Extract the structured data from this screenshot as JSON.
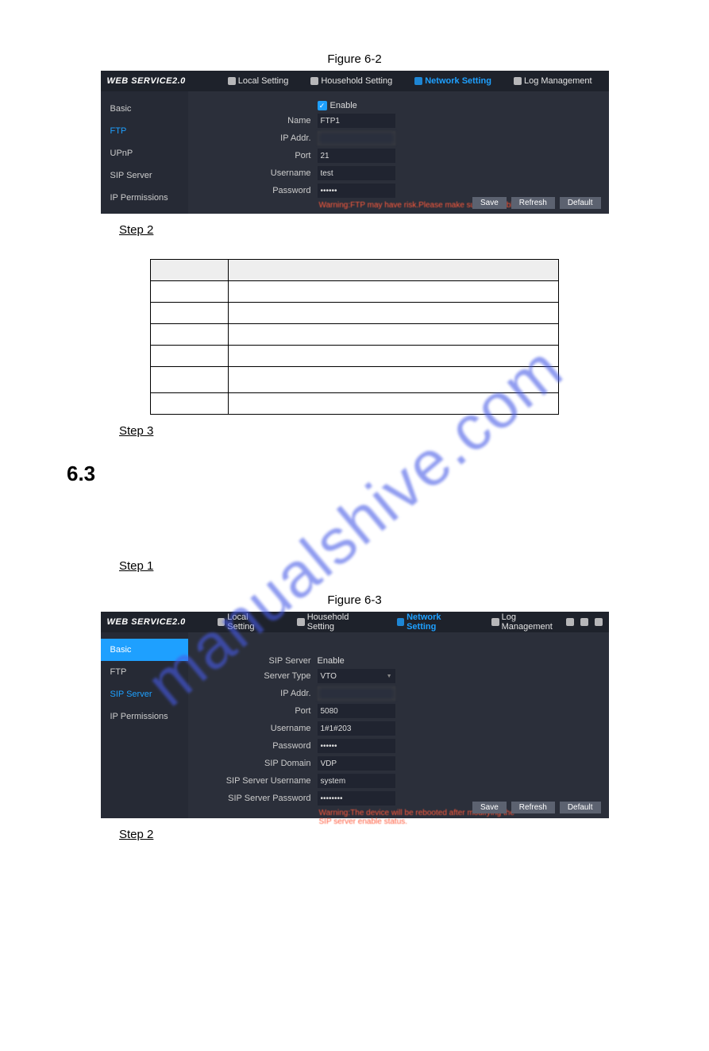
{
  "watermark": "manualshive.com",
  "figure1_caption": "Figure 6-2",
  "figure2_caption": "Figure 6-3",
  "step1_text": "Step 1",
  "step2_text": "Step 2",
  "step3_text": "Step 3",
  "section_num": "6.3",
  "shot": {
    "logo": "WEB SERVICE2.0",
    "nav": {
      "local": "Local Setting",
      "household": "Household Setting",
      "network": "Network Setting",
      "log": "Log Management"
    },
    "sidebar": {
      "basic": "Basic",
      "ftp": "FTP",
      "upnp": "UPnP",
      "sip": "SIP Server",
      "ipperm": "IP Permissions"
    },
    "buttons": {
      "save": "Save",
      "refresh": "Refresh",
      "default": "Default"
    }
  },
  "ftp_form": {
    "enable_label": "Enable",
    "name_label": "Name",
    "name_value": "FTP1",
    "ip_label": "IP Addr.",
    "ip_value": "",
    "port_label": "Port",
    "port_value": "21",
    "user_label": "Username",
    "user_value": "test",
    "pass_label": "Password",
    "pass_value": "••••••",
    "warning": "Warning:FTP may have risk.Please make sure to enable."
  },
  "sip_form": {
    "sipserver_label": "SIP Server",
    "enable_label": "Enable",
    "servertype_label": "Server Type",
    "servertype_value": "VTO",
    "ip_label": "IP Addr.",
    "ip_value": "",
    "port_label": "Port",
    "port_value": "5080",
    "user_label": "Username",
    "user_value": "1#1#203",
    "pass_label": "Password",
    "pass_value": "••••••",
    "domain_label": "SIP Domain",
    "domain_value": "VDP",
    "srvuser_label": "SIP Server Username",
    "srvuser_value": "system",
    "srvpass_label": "SIP Server Password",
    "srvpass_value": "••••••••",
    "warning": "Warning:The device will be rebooted after modifying the SIP server enable status."
  }
}
